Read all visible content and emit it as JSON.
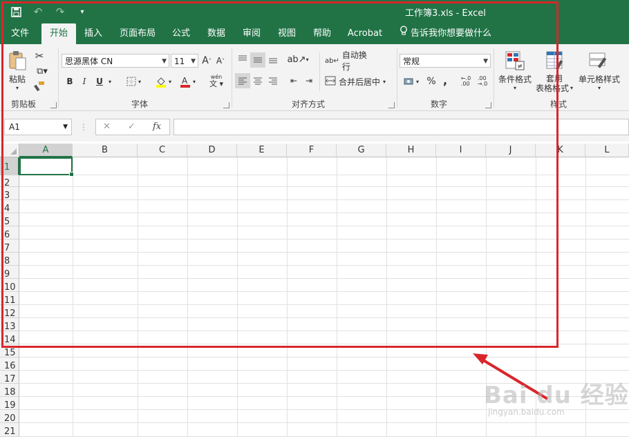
{
  "window": {
    "title": "工作簿3.xls  -  Excel"
  },
  "tabs": [
    {
      "label": "文件"
    },
    {
      "label": "开始"
    },
    {
      "label": "插入"
    },
    {
      "label": "页面布局"
    },
    {
      "label": "公式"
    },
    {
      "label": "数据"
    },
    {
      "label": "审阅"
    },
    {
      "label": "视图"
    },
    {
      "label": "帮助"
    },
    {
      "label": "Acrobat"
    }
  ],
  "tell_me": "告诉我你想要做什么",
  "ribbon": {
    "clipboard": {
      "label": "剪贴板",
      "paste": "粘贴"
    },
    "font": {
      "label": "字体",
      "font_name": "思源黑体 CN",
      "font_size": "11",
      "bold": "B",
      "italic": "I",
      "underline": "U",
      "phonetic": "wén"
    },
    "alignment": {
      "label": "对齐方式",
      "wrap": "自动换行",
      "merge": "合并后居中"
    },
    "number": {
      "label": "数字",
      "format": "常规",
      "percent": "%",
      "comma": ","
    },
    "styles": {
      "label": "样式",
      "conditional": "条件格式",
      "table_a": "套用",
      "table_b": "表格格式",
      "cell_styles": "单元格样式"
    }
  },
  "formula": {
    "namebox": "A1",
    "fx": "fx"
  },
  "columns": [
    "A",
    "B",
    "C",
    "D",
    "E",
    "F",
    "G",
    "H",
    "I",
    "J",
    "K",
    "L"
  ],
  "rows": [
    "1",
    "2",
    "3",
    "4",
    "5",
    "6",
    "7",
    "8",
    "9",
    "10",
    "11",
    "12",
    "13",
    "14",
    "15",
    "16",
    "17",
    "18",
    "19",
    "20",
    "21"
  ],
  "colors": {
    "brand": "#217346",
    "annotation": "#d9262b"
  },
  "watermark": {
    "main": "Bai du 经验",
    "sub": "jingyan.baidu.com"
  }
}
